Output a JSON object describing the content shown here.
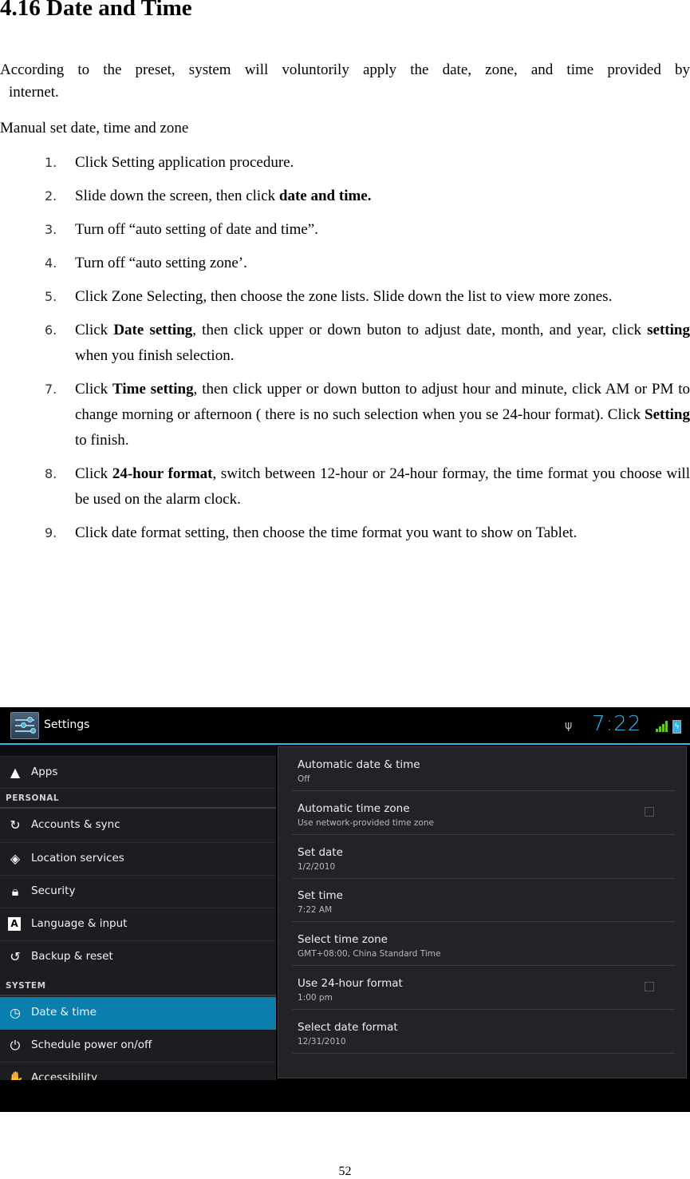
{
  "heading": "4.16 Date and Time",
  "intro": {
    "line1": "According to the preset, system will voluntorily apply the date, zone, and time provided by",
    "line2": "internet."
  },
  "subheading": "Manual set date, time and zone",
  "steps": [
    {
      "num": "1.",
      "parts": [
        {
          "t": "Click Setting application procedure."
        }
      ]
    },
    {
      "num": "2.",
      "parts": [
        {
          "t": "Slide down the screen, then click "
        },
        {
          "t": "date and time.",
          "b": true
        }
      ]
    },
    {
      "num": "3.",
      "parts": [
        {
          "t": "Turn off “auto setting of date and time”."
        }
      ]
    },
    {
      "num": "4.",
      "parts": [
        {
          "t": "Turn off “auto setting zone’."
        }
      ]
    },
    {
      "num": "5.",
      "parts": [
        {
          "t": "Click Zone Selecting, then choose the zone lists. Slide down the list to view more zones."
        }
      ]
    },
    {
      "num": "6.",
      "parts": [
        {
          "t": "Click "
        },
        {
          "t": "Date setting",
          "b": true
        },
        {
          "t": ", then click upper or down buton to adjust date, month, and year, click "
        },
        {
          "t": "setting",
          "b": true
        },
        {
          "t": " when you finish selection."
        }
      ]
    },
    {
      "num": "7.",
      "parts": [
        {
          "t": "Click "
        },
        {
          "t": "Time setting",
          "b": true
        },
        {
          "t": ", then click upper or down button to adjust hour and minute, click AM or PM to change morning or afternoon ( there is no such selection when you se 24-hour format). Click "
        },
        {
          "t": "Setting",
          "b": true
        },
        {
          "t": " to finish."
        }
      ]
    },
    {
      "num": "8.",
      "parts": [
        {
          "t": "Click "
        },
        {
          "t": "24-hour format",
          "b": true
        },
        {
          "t": ", switch between 12-hour or 24-hour formay, the time format you choose will be used on the alarm clock."
        }
      ]
    },
    {
      "num": "9.",
      "parts": [
        {
          "t": "Click date format setting, then choose the time format you want to show on Tablet."
        }
      ]
    }
  ],
  "device": {
    "app_title": "Settings",
    "status": {
      "usb": "ψ",
      "clock": "7:22",
      "battery": "ϟ"
    },
    "colors": {
      "accent": "#33b5e5",
      "active": "#0a7fae",
      "signal": "#6cc02b"
    },
    "left_items": {
      "apps": {
        "icon": "▲",
        "label": "Apps"
      },
      "personal_header": "PERSONAL",
      "accounts": {
        "icon": "↻",
        "label": "Accounts & sync"
      },
      "location": {
        "icon": "◈",
        "label": "Location services"
      },
      "security": {
        "icon": "🔒︎",
        "label": "Security"
      },
      "language": {
        "icon": "A",
        "label": "Language & input"
      },
      "backup": {
        "icon": "↺",
        "label": "Backup & reset"
      },
      "system_header": "SYSTEM",
      "datetime": {
        "icon": "◷",
        "label": "Date & time"
      },
      "schedule": {
        "icon": "⏻",
        "label": "Schedule power on/off"
      },
      "accessibility": {
        "icon": "✋",
        "label": "Accessibility"
      }
    },
    "right_items": [
      {
        "title": "Automatic date & time",
        "summary": "Off"
      },
      {
        "title": "Automatic time zone",
        "summary": "Use network-provided time zone",
        "checked": false
      },
      {
        "title": "Set date",
        "summary": "1/2/2010"
      },
      {
        "title": "Set time",
        "summary": "7:22 AM"
      },
      {
        "title": "Select time zone",
        "summary": "GMT+08:00, China Standard Time"
      },
      {
        "title": "Use 24-hour format",
        "summary": "1:00 pm",
        "checked": false
      },
      {
        "title": "Select date format",
        "summary": "12/31/2010"
      }
    ]
  },
  "page_number": "52"
}
